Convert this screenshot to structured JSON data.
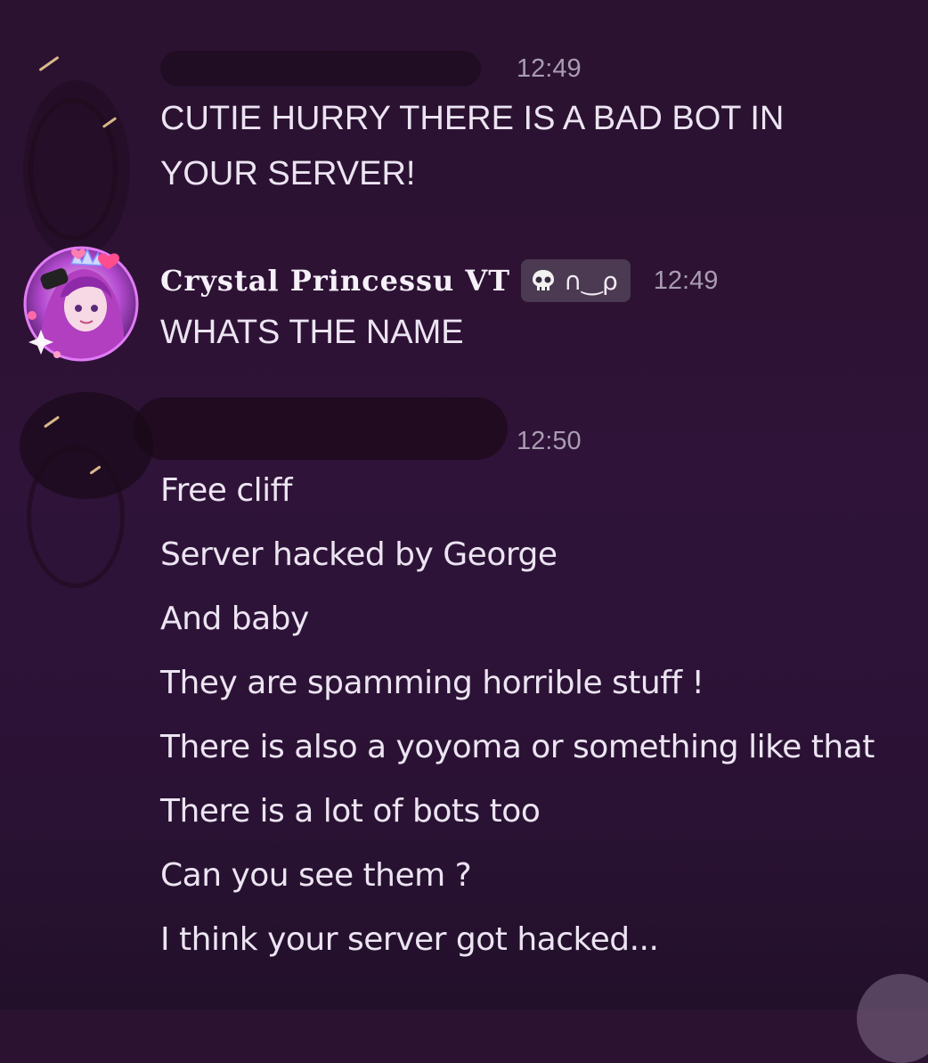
{
  "messages": [
    {
      "id": "m1",
      "author": "",
      "timestamp": "12:49",
      "lines": [
        "CUTIE HURRY THERE IS A BAD BOT IN",
        "YOUR SERVER!"
      ]
    },
    {
      "id": "m2",
      "author": "Crystal Princessu VT",
      "badge": {
        "icon": "skull-icon",
        "text": "∩‿ρ"
      },
      "timestamp": "12:49",
      "lines": [
        "WHATS THE NAME"
      ]
    },
    {
      "id": "m3",
      "author": "",
      "timestamp": "12:50",
      "lines": [
        "Free cliff",
        "Server hacked by George",
        "And baby",
        "They are spamming horrible stuff !",
        "There is also a yoyoma or something like that",
        "There is a lot of bots too",
        "Can you see them ?",
        "I think your server got hacked..."
      ]
    }
  ],
  "colors": {
    "background": "#2d1233",
    "text": "#ece4f2",
    "timestamp": "#a99cb2",
    "badge_bg": "#4b3a52"
  }
}
